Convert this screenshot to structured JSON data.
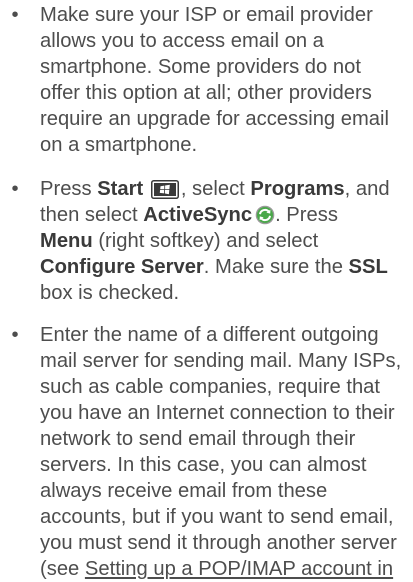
{
  "bullets": [
    {
      "lines": [
        "Make sure your ISP or email provider",
        "allows you to access email on a",
        "smartphone. Some providers do not",
        "offer this option at all; other providers",
        "require an upgrade for accessing email",
        "on a smartphone."
      ]
    },
    {
      "t": {
        "press": "Press ",
        "start": "Start",
        "select1": ", select ",
        "programs": "Programs",
        "and": ", and",
        "then_select": "then select ",
        "activesync": "ActiveSync",
        "press2": ". Press",
        "menu": "Menu",
        "right_softkey": " (right softkey) and select",
        "configure_server": "Configure Server",
        "make_sure": ". Make sure the ",
        "ssl": "SSL",
        "box_checked": "box is checked."
      },
      "icons": {
        "start_key": "windows-start-key-icon",
        "activesync": "activesync-icon"
      }
    },
    {
      "lines": [
        "Enter the name of a different outgoing",
        "mail server for sending mail. Many ISPs,",
        "such as cable companies, require that",
        "you have an Internet connection to their",
        "network to send email through their",
        "servers. In this case, you can almost",
        "always receive email from these",
        "accounts, but if you want to send email,",
        "you must send it through another server"
      ],
      "last_line_prefix": "(see ",
      "link_text": "Setting up a POP/IMAP account in"
    }
  ],
  "bullet_char": "•",
  "colors": {
    "text": "#4d4d4d",
    "bold": "#3a3a3a",
    "activesync_green": "#3aa23a"
  }
}
